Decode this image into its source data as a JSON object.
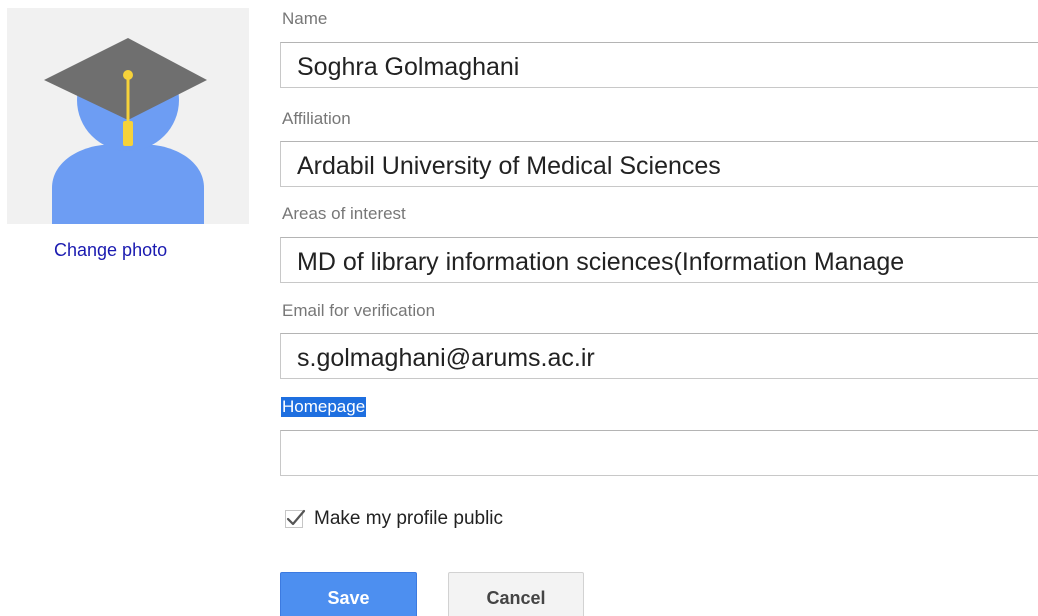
{
  "profile": {
    "change_photo_label": "Change photo"
  },
  "form": {
    "name": {
      "label": "Name",
      "value": "Soghra Golmaghani"
    },
    "affiliation": {
      "label": "Affiliation",
      "value": "Ardabil University of Medical Sciences"
    },
    "interests": {
      "label": "Areas of interest",
      "value": "MD of library information sciences(Information Manage"
    },
    "email": {
      "label": "Email for verification",
      "value": "s.golmaghani@arums.ac.ir"
    },
    "homepage": {
      "label": "Homepage",
      "value": ""
    },
    "public_checkbox": {
      "label": "Make my profile public",
      "checked": true
    }
  },
  "actions": {
    "save_label": "Save",
    "cancel_label": "Cancel"
  },
  "colors": {
    "avatar_body": "#6d9df3",
    "cap": "#6f6f6f",
    "tassel": "#f6d23a",
    "save_button": "#4d8ff0",
    "link": "#1a1ab0",
    "selection": "#1e6fe0"
  },
  "icons": {
    "avatar": "graduate-avatar-icon",
    "checkmark": "checkmark-icon"
  }
}
